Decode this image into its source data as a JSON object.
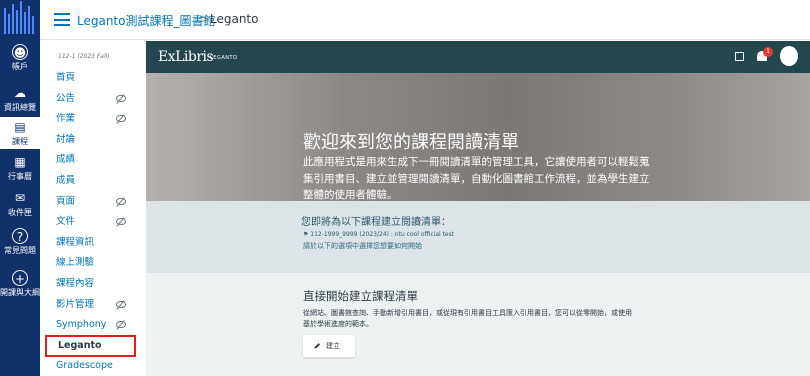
{
  "global_nav": {
    "items": [
      {
        "label": "帳戶",
        "icon": "user-icon"
      },
      {
        "label": "資訊總覽",
        "icon": "dashboard-icon"
      },
      {
        "label": "課程",
        "icon": "courses-icon"
      },
      {
        "label": "行事曆",
        "icon": "calendar-icon"
      },
      {
        "label": "收件匣",
        "icon": "inbox-icon"
      },
      {
        "label": "常見問題",
        "icon": "help-icon"
      },
      {
        "label": "開課與大綱",
        "icon": "add-course-icon"
      }
    ],
    "active_index": 2,
    "colors": {
      "background": "#10316b",
      "accent": "#4f88ff"
    }
  },
  "breadcrumb": {
    "course": "Leganto測試課程_圖書館",
    "separator": ">",
    "current": "Leganto"
  },
  "course_nav": {
    "term": "112-1 (2023 Fall)",
    "items": [
      {
        "label": "首頁",
        "hidden": false
      },
      {
        "label": "公告",
        "hidden": true
      },
      {
        "label": "作業",
        "hidden": true
      },
      {
        "label": "討論",
        "hidden": false
      },
      {
        "label": "成績",
        "hidden": false
      },
      {
        "label": "成員",
        "hidden": false
      },
      {
        "label": "頁面",
        "hidden": true
      },
      {
        "label": "文件",
        "hidden": true
      },
      {
        "label": "課程資訊",
        "hidden": false
      },
      {
        "label": "線上測驗",
        "hidden": false
      },
      {
        "label": "課程內容",
        "hidden": false
      },
      {
        "label": "影片管理",
        "hidden": true
      },
      {
        "label": "Symphony",
        "hidden": true
      },
      {
        "label": "Leganto",
        "hidden": false,
        "current": true
      },
      {
        "label": "Gradescope",
        "hidden": false
      }
    ]
  },
  "leganto": {
    "logo": "ExLibris",
    "logo_sub": "LEGANTO",
    "notification_count": "1",
    "welcome_title": "歡迎來到您的課程閱讀清單",
    "welcome_text": "此應用程式是用來生成下一冊閱讀清單的管理工具，它讓使用者可以輕鬆蒐集引用書目、建立並管理閱讀清單，自動化圖書館工作流程，並為學生建立整體的使用者體驗。",
    "create_for_title": "您即將為以下課程建立閱讀清單：",
    "course_code": "112-1999_9999 (2023/24) : ntu cool official test",
    "choose_hint": "請於以下的選項中選擇您想要如何開始",
    "start_title": "直接開始建立課程清單",
    "start_text": "從網站、圖書館查詢、手動新增引用書目，或從現有引用書目工具匯入引用書目，您可以從零開始，或使用基於學術進度的範本。",
    "new_button": "建立",
    "colors": {
      "header": "#24474e",
      "badge": "#e03c31"
    }
  }
}
